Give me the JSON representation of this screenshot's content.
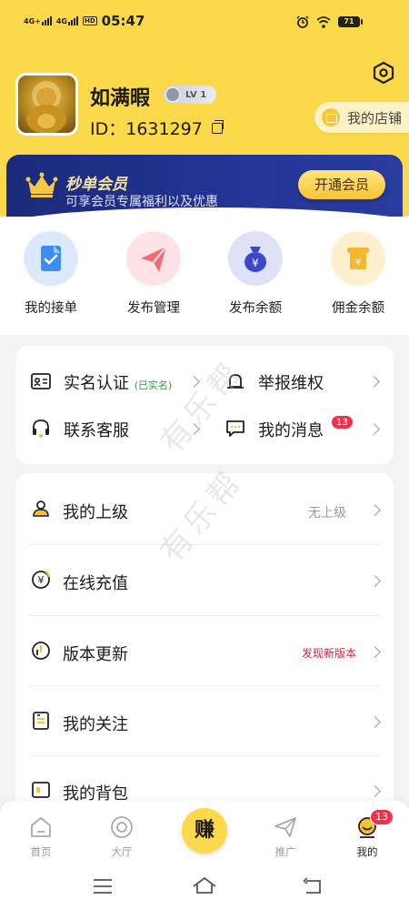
{
  "status_bar": {
    "network_1": "4G+",
    "network_2": "4G",
    "hd": "HD",
    "time": "05:47",
    "battery": "71"
  },
  "profile": {
    "name": "如满暇",
    "level": "LV 1",
    "id_text": "ID：1631297"
  },
  "store_button": "我的店铺",
  "vip": {
    "title": "秒单会员",
    "subtitle": "可享会员专属福利以及优惠",
    "button": "开通会员"
  },
  "quick_actions": [
    {
      "label": "我的接单",
      "icon": "document-check-icon",
      "color": "#3b8df0"
    },
    {
      "label": "发布管理",
      "icon": "paper-plane-icon",
      "color": "#f06a7a"
    },
    {
      "label": "发布余额",
      "icon": "money-bag-icon",
      "color": "#3e47c9"
    },
    {
      "label": "佣金余额",
      "icon": "coin-card-icon",
      "color": "#f5b82c"
    }
  ],
  "card1": {
    "verify": "实名认证",
    "verified_tag": "(已实名)",
    "report": "举报维权",
    "service": "联系客服",
    "messages": "我的消息",
    "messages_badge": "13"
  },
  "menu": [
    {
      "label": "我的上级",
      "value": "无上级",
      "value_color": "#999999"
    },
    {
      "label": "在线充值",
      "value": ""
    },
    {
      "label": "版本更新",
      "value": "发现新版本",
      "value_color": "#d8243a"
    },
    {
      "label": "我的关注",
      "value": ""
    },
    {
      "label": "我的背包",
      "value": ""
    }
  ],
  "watermark": "有乐帮",
  "nav": {
    "home": "首页",
    "hall": "大厅",
    "earn": "赚",
    "promote": "推广",
    "mine": "我的",
    "mine_badge": "13"
  },
  "colors": {
    "brand_yellow": "#fbd94a",
    "vip_blue": "#1b2a7a",
    "badge_red": "#f2304c"
  }
}
